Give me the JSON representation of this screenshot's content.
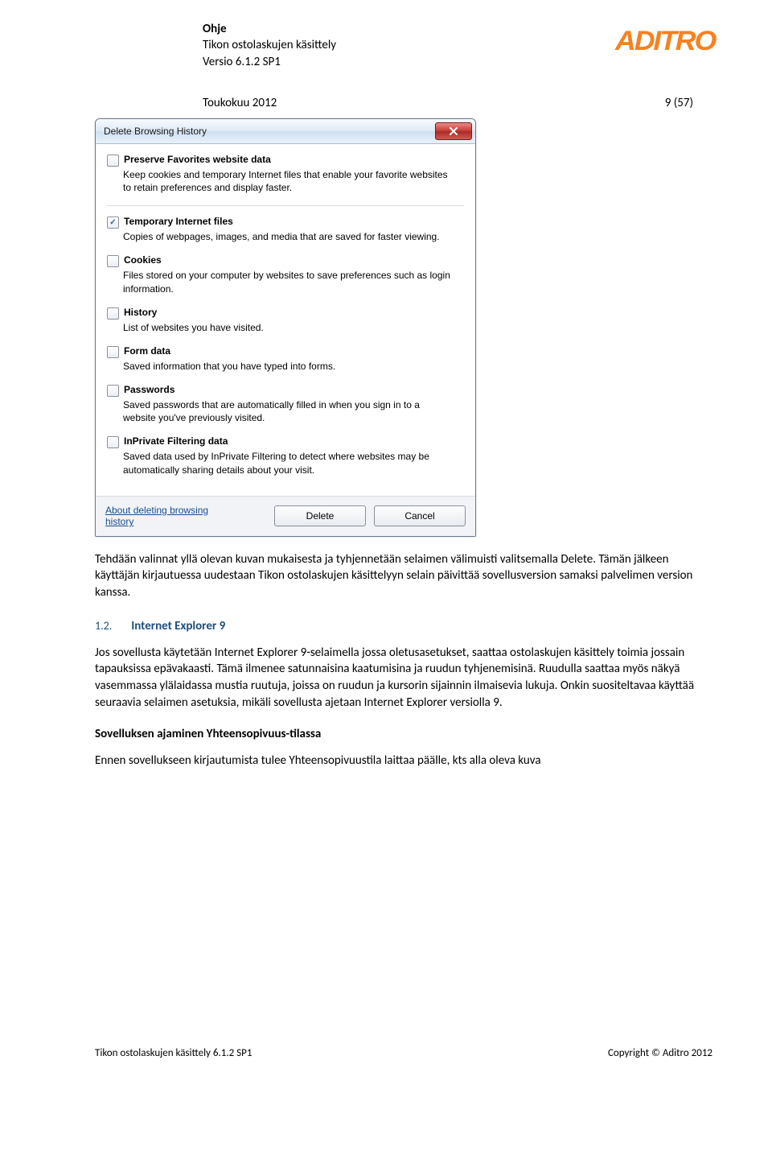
{
  "header": {
    "title": "Ohje",
    "subtitle": "Tikon ostolaskujen käsittely",
    "version": "Versio 6.1.2 SP1",
    "date": "Toukokuu 2012",
    "page": "9 (57)",
    "brand": "ADITRO"
  },
  "dialog": {
    "title": "Delete Browsing History",
    "items": [
      {
        "checked": false,
        "title": "Preserve Favorites website data",
        "desc": "Keep cookies and temporary Internet files that enable your favorite websites to retain preferences and display faster.",
        "divider_after": true
      },
      {
        "checked": true,
        "title": "Temporary Internet files",
        "desc": "Copies of webpages, images, and media that are saved for faster viewing."
      },
      {
        "checked": false,
        "title": "Cookies",
        "desc": "Files stored on your computer by websites to save preferences such as login information."
      },
      {
        "checked": false,
        "title": "History",
        "desc": "List of websites you have visited."
      },
      {
        "checked": false,
        "title": "Form data",
        "desc": "Saved information that you have typed into forms."
      },
      {
        "checked": false,
        "title": "Passwords",
        "desc": "Saved passwords that are automatically filled in when you sign in to a website you've previously visited."
      },
      {
        "checked": false,
        "title": "InPrivate Filtering data",
        "desc": "Saved data used by InPrivate Filtering to detect where websites may be automatically sharing details about your visit."
      }
    ],
    "about": "About deleting browsing history",
    "delete": "Delete",
    "cancel": "Cancel"
  },
  "body": {
    "p1": "Tehdään valinnat yllä olevan kuvan mukaisesta ja tyhjennetään selaimen välimuisti valitsemalla Delete. Tämän jälkeen käyttäjän kirjautuessa uudestaan Tikon ostolaskujen käsittelyyn selain päivittää sovellusversion samaksi palvelimen version kanssa.",
    "sec_num": "1.2.",
    "sec_title": "Internet Explorer 9",
    "p2": "Jos sovellusta käytetään Internet Explorer 9-selaimella jossa oletusasetukset, saattaa ostolaskujen käsittely toimia jossain tapauksissa epävakaasti. Tämä ilmenee satunnaisina kaatumisina ja ruudun tyhjenemisinä. Ruudulla saattaa myös näkyä vasemmassa ylälaidassa mustia ruutuja, joissa on ruudun ja kursorin sijainnin ilmaisevia lukuja. Onkin suositeltavaa käyttää seuraavia selaimen asetuksia, mikäli sovellusta ajetaan Internet Explorer versiolla 9.",
    "sub": "Sovelluksen ajaminen Yhteensopivuus-tilassa",
    "p3": "Ennen sovellukseen kirjautumista tulee Yhteensopivuustila laittaa päälle, kts alla oleva kuva"
  },
  "footer": {
    "left": "Tikon ostolaskujen käsittely 6.1.2 SP1",
    "right": "Copyright © Aditro 2012"
  }
}
